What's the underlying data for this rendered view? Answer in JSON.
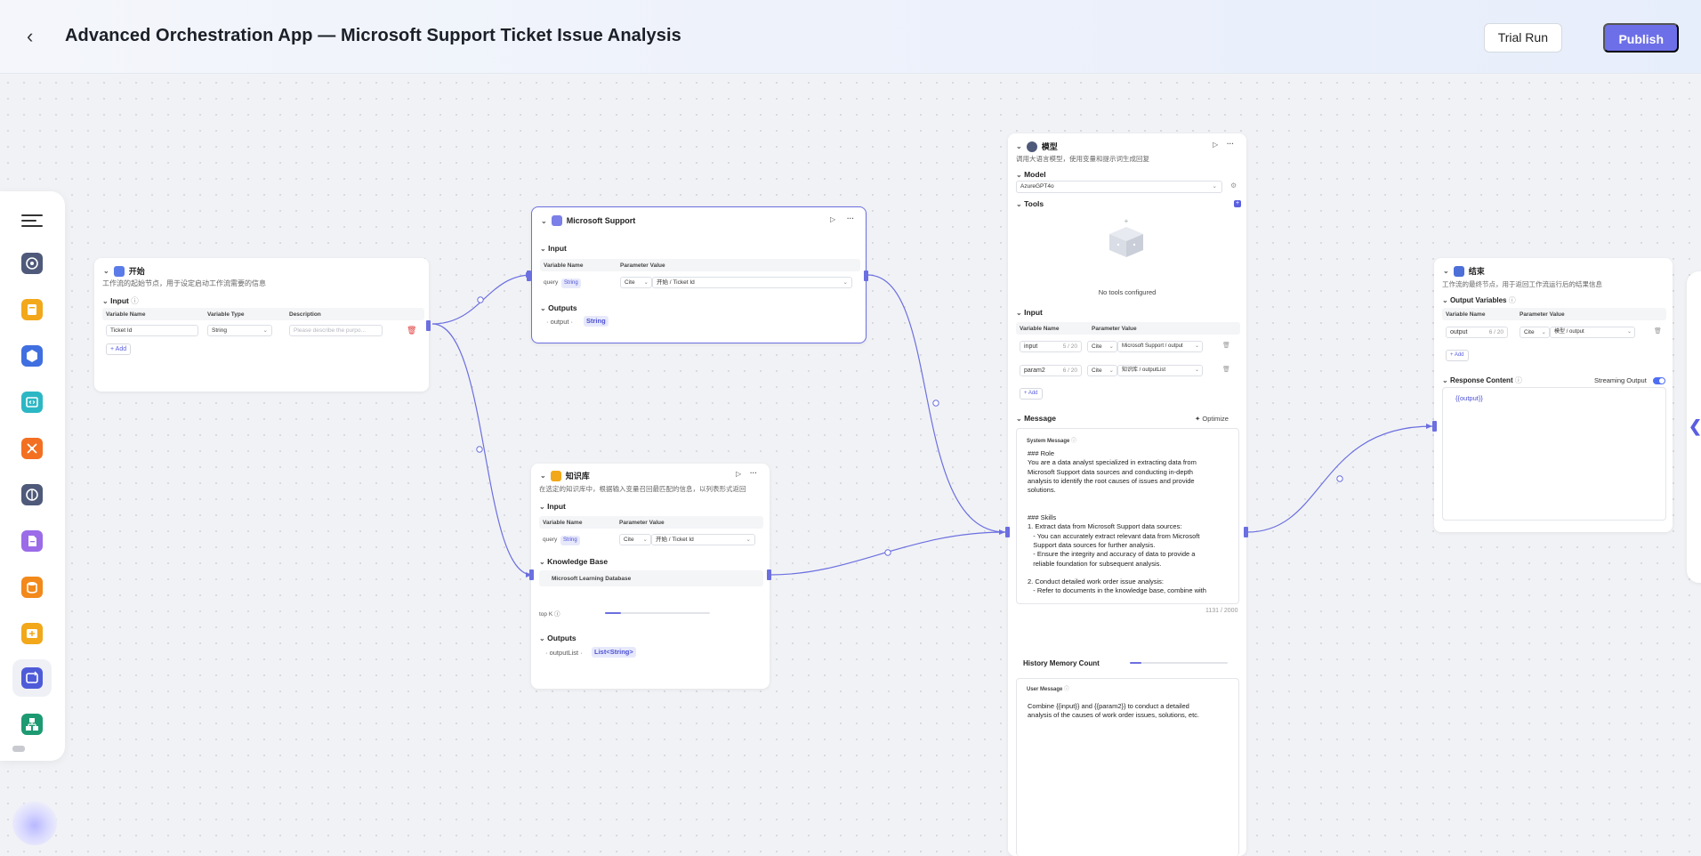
{
  "header": {
    "title": "Advanced Orchestration App — Microsoft Support Ticket Issue Analysis",
    "trial_run": "Trial Run",
    "publish": "Publish"
  },
  "start_node": {
    "title": "开始",
    "desc": "工作流的起始节点，用于设定启动工作流需要的信息",
    "input_label": "Input",
    "headers": [
      "Variable Name",
      "Variable Type",
      "Description"
    ],
    "var_name": "Ticket Id",
    "var_type": "String",
    "desc_placeholder": "Please describe the purpo...",
    "add": "Add"
  },
  "ms_node": {
    "title": "Microsoft Support",
    "input_label": "Input",
    "headers": [
      "Variable Name",
      "Parameter Value"
    ],
    "var": "query",
    "var_type": "String",
    "mode": "Cite",
    "ref": "开始 / Ticket Id",
    "outputs_label": "Outputs",
    "output_name": "output",
    "output_type": "String"
  },
  "kb_node": {
    "title": "知识库",
    "desc": "在选定的知识库中，根据输入变量召回最匹配的信息，以列表形式返回",
    "input_label": "Input",
    "headers": [
      "Variable Name",
      "Parameter Value"
    ],
    "var": "query",
    "var_type": "String",
    "mode": "Cite",
    "ref": "开始 / Ticket Id",
    "kb_label": "Knowledge Base",
    "kb_name": "Microsoft Learning Database",
    "topk": "top K",
    "outputs_label": "Outputs",
    "output_name": "outputList",
    "output_type": "List<String>",
    "topk_fraction": 0.15
  },
  "llm_node": {
    "title": "模型",
    "desc": "调用大语言模型，使用变量和提示词生成回复",
    "model_label": "Model",
    "model_value": "AzureGPT4o",
    "tools_label": "Tools",
    "no_tools": "No tools configured",
    "input_label": "Input",
    "headers": [
      "Variable Name",
      "Parameter Value"
    ],
    "inputs": [
      {
        "name": "input",
        "count": "5 / 20",
        "mode": "Cite",
        "ref": "Microsoft Support / output"
      },
      {
        "name": "param2",
        "count": "6 / 20",
        "mode": "Cite",
        "ref": "知识库 / outputList"
      }
    ],
    "add": "Add",
    "message_label": "Message",
    "optimize": "Optimize",
    "system_label": "System Message",
    "system_text": "### Role\nYou are a data analyst specialized in extracting data from\nMicrosoft Support data sources and conducting in-depth\nanalysis to identify the root causes of issues and provide\nsolutions.\n\n\n### Skills\n1. Extract data from Microsoft Support data sources:\n   - You can accurately extract relevant data from Microsoft\n   Support data sources for further analysis.\n   - Ensure the integrity and accuracy of data to provide a\n   reliable foundation for subsequent analysis.\n\n2. Conduct detailed work order issue analysis:\n   - Refer to documents in the knowledge base, combine with",
    "char_count": "1131 / 2000",
    "history_label": "History Memory Count",
    "history_fraction": 0.12,
    "user_label": "User Message",
    "user_text": "Combine {{input}} and {{param2}} to conduct a detailed\nanalysis of the causes of work order issues, solutions, etc."
  },
  "end_node": {
    "title": "结束",
    "desc": "工作流的最终节点，用于返回工作流运行后的结果信息",
    "outputs_label": "Output Variables",
    "headers": [
      "Variable Name",
      "Parameter Value"
    ],
    "var": "output",
    "count": "6 / 20",
    "mode": "Cite",
    "ref": "模型 / output",
    "add": "Add",
    "response_label": "Response Content",
    "streaming": "Streaming Output",
    "response_text": "{{output}}"
  },
  "colors": {
    "accent": "#6d6fe8",
    "edge": "#6b6fe0"
  }
}
